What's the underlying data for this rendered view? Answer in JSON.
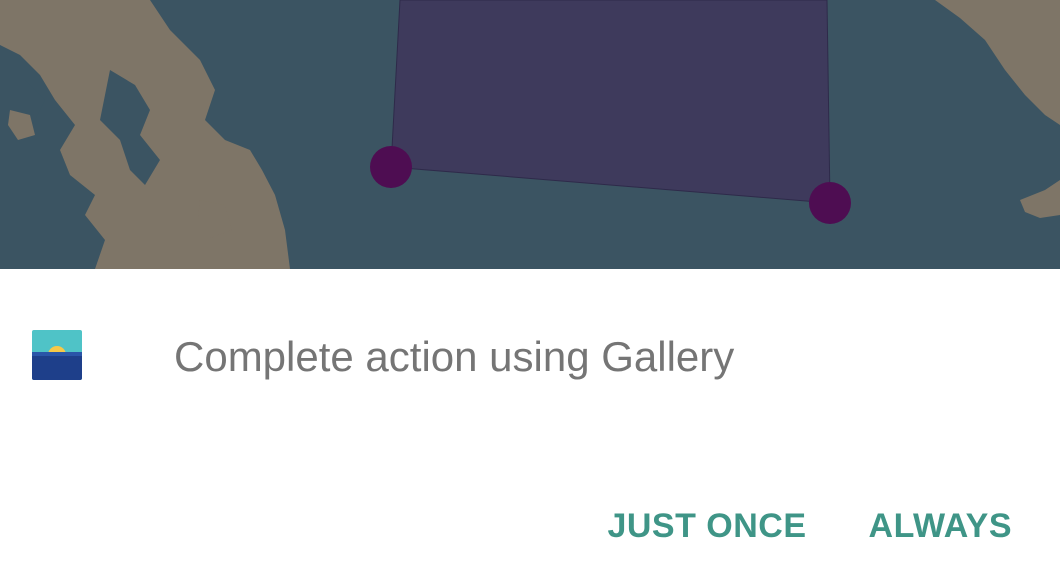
{
  "map": {
    "water_color": "#3b5462",
    "land_color": "#7e7567",
    "polygon_fill_color": "#3e3a5c",
    "marker_color": "#4e0d52"
  },
  "chooser": {
    "app_icon": "gallery-app-icon",
    "title": "Complete action using Gallery",
    "buttons": {
      "just_once": "JUST ONCE",
      "always": "ALWAYS"
    },
    "accent_color": "#3f9587"
  }
}
